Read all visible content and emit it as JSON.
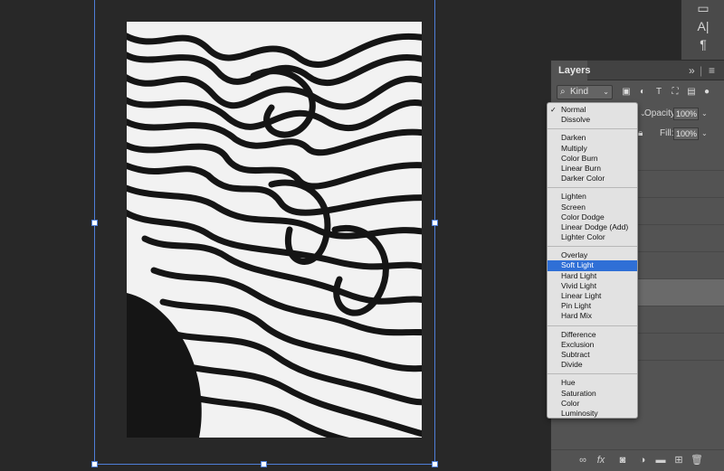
{
  "tool_strip": {
    "icons": [
      "brush-preset-icon",
      "character-icon",
      "paragraph-icon"
    ],
    "character_glyph": "A|",
    "paragraph_glyph": "¶"
  },
  "layers_panel": {
    "tab_label": "Layers",
    "collapse_glyph": "»",
    "menu_glyph": "≡",
    "filter": {
      "kind_label": "Kind"
    },
    "opacity": {
      "label": "Opacity:",
      "value": "100%"
    },
    "fill": {
      "label": "Fill:",
      "value": "100%"
    },
    "footer_icons": [
      "link-icon",
      "fx-icon",
      "mask-icon",
      "adjustment-icon",
      "folder-icon",
      "new-layer-icon",
      "trash-icon"
    ],
    "fx_label": "fx"
  },
  "blend_menu": {
    "checked": "Normal",
    "highlighted": "Soft Light",
    "groups": [
      [
        "Normal",
        "Dissolve"
      ],
      [
        "Darken",
        "Multiply",
        "Color Burn",
        "Linear Burn",
        "Darker Color"
      ],
      [
        "Lighten",
        "Screen",
        "Color Dodge",
        "Linear Dodge (Add)",
        "Lighter Color"
      ],
      [
        "Overlay",
        "Soft Light",
        "Hard Light",
        "Vivid Light",
        "Linear Light",
        "Pin Light",
        "Hard Mix"
      ],
      [
        "Difference",
        "Exclusion",
        "Subtract",
        "Divide"
      ],
      [
        "Hue",
        "Saturation",
        "Color",
        "Luminosity"
      ]
    ]
  },
  "colors": {
    "workspace": "#282828",
    "panel": "#535353",
    "selection_blue": "#2f6fd6",
    "bbox_blue": "#4f7fd8"
  }
}
